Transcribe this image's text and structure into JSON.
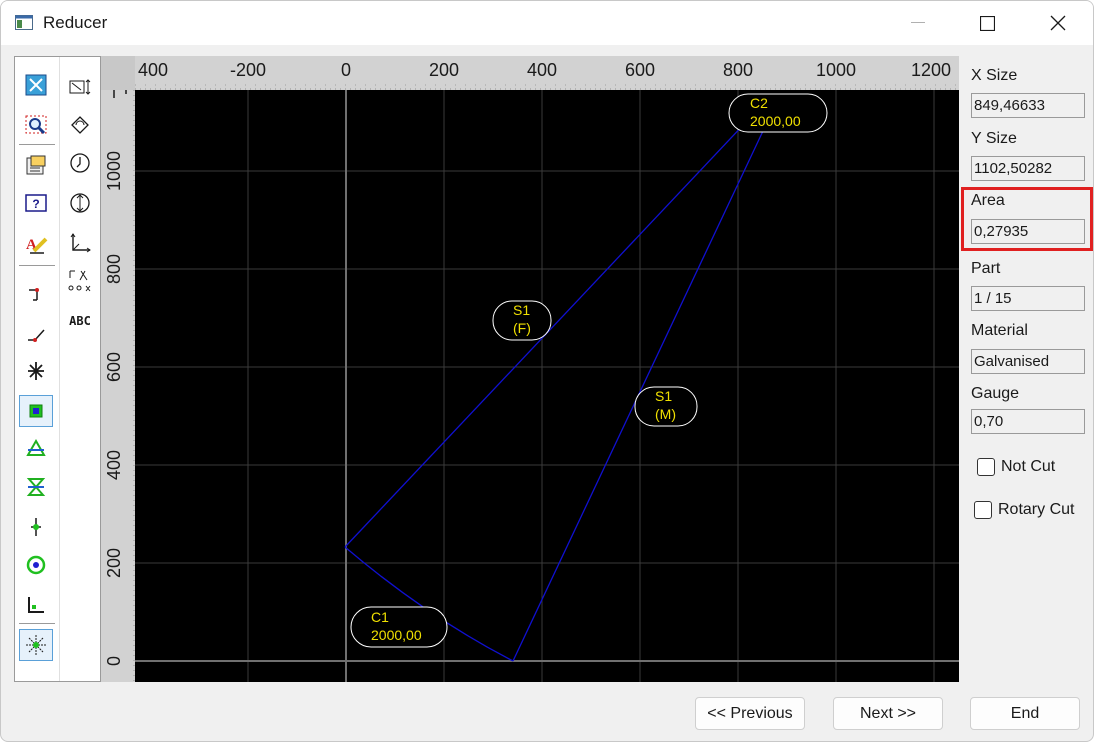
{
  "window": {
    "title": "Reducer",
    "app_icon": "app-window-icon"
  },
  "toolbar": {
    "left_column": [
      "zoom-extents-icon",
      "zoom-window-icon",
      "properties-icon",
      "help-icon",
      "text-style-icon",
      "step-line-icon",
      "angled-line-icon",
      "asterisk-icon",
      "node-square-icon",
      "triangle-node-icon",
      "hourglass-node-icon",
      "cross-node-icon",
      "target-node-icon",
      "corner-icon",
      "snap-star-icon"
    ],
    "right_column": [
      "resize-icon",
      "rotate-icon",
      "clock-icon",
      "flip-icon",
      "axes-icon",
      "dimension-icon",
      "abc-text-icon"
    ],
    "abc_label": "ABC"
  },
  "canvas": {
    "x_ruler_labels": [
      "400",
      "-200",
      "0",
      "200",
      "400",
      "600",
      "800",
      "1000",
      "1200"
    ],
    "y_ruler_labels": [
      "0",
      "200",
      "400",
      "600",
      "800",
      "1000"
    ],
    "labels": [
      {
        "line1": "C2",
        "line2": "2000,00"
      },
      {
        "line1": "S1",
        "line2": "(F)"
      },
      {
        "line1": "S1",
        "line2": "(M)"
      },
      {
        "line1": "C1",
        "line2": "2000,00"
      }
    ],
    "colors": {
      "background": "#000000",
      "grid": "#3a3a3a",
      "axis": "#707070",
      "shape": "#1010d0",
      "label_text": "#f0e000",
      "label_border": "#ffffff"
    }
  },
  "properties": {
    "x_size_label": "X Size",
    "x_size_value": "849,46633",
    "y_size_label": "Y Size",
    "y_size_value": "1102,50282",
    "area_label": "Area",
    "area_value": "0,27935",
    "part_label": "Part",
    "part_value": "1 / 15",
    "material_label": "Material",
    "material_value": "Galvanised",
    "gauge_label": "Gauge",
    "gauge_value": "0,70",
    "not_cut_label": "Not Cut",
    "not_cut_checked": false,
    "rotary_cut_label": "Rotary Cut",
    "rotary_cut_checked": false,
    "highlight_color": "#e02020"
  },
  "buttons": {
    "previous": "<< Previous",
    "next": "Next >>",
    "end": "End"
  }
}
